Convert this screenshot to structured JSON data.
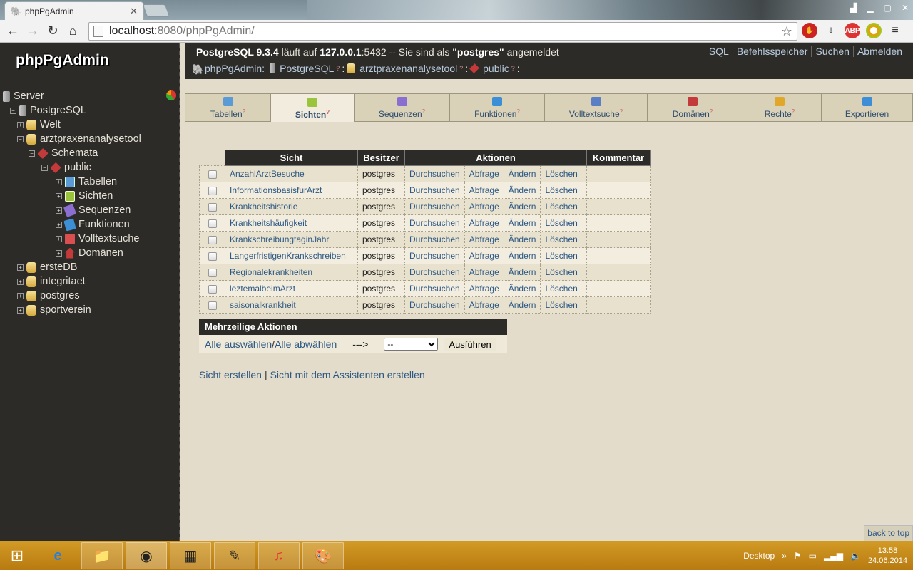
{
  "browser": {
    "tab_title": "phpPgAdmin",
    "url_host": "localhost",
    "url_path": ":8080/phpPgAdmin/"
  },
  "sidebar": {
    "logo": "phpPgAdmin",
    "tree": [
      {
        "label": "Server",
        "icon": "server-icon"
      },
      {
        "label": "PostgreSQL",
        "icon": "server-icon"
      },
      {
        "label": "Welt",
        "icon": "database-icon"
      },
      {
        "label": "arztpraxenanalysetool",
        "icon": "database-icon"
      },
      {
        "label": "Schemata",
        "icon": "schemas-icon"
      },
      {
        "label": "public",
        "icon": "schema-icon"
      },
      {
        "label": "Tabellen",
        "icon": "tables-icon"
      },
      {
        "label": "Sichten",
        "icon": "views-icon"
      },
      {
        "label": "Sequenzen",
        "icon": "sequences-icon"
      },
      {
        "label": "Funktionen",
        "icon": "functions-icon"
      },
      {
        "label": "Volltextsuche",
        "icon": "fulltext-icon"
      },
      {
        "label": "Domänen",
        "icon": "domains-icon"
      },
      {
        "label": "ersteDB",
        "icon": "database-icon"
      },
      {
        "label": "integritaet",
        "icon": "database-icon"
      },
      {
        "label": "postgres",
        "icon": "database-icon"
      },
      {
        "label": "sportverein",
        "icon": "database-icon"
      }
    ]
  },
  "topbar": {
    "version": "PostgreSQL 9.3.4",
    "runs_on": " läuft auf ",
    "host": "127.0.0.1",
    "port": ":5432 -- Sie sind als ",
    "user": "\"postgres\"",
    "logged": " angemeldet",
    "links": [
      "SQL",
      "Befehlsspeicher",
      "Suchen",
      "Abmelden"
    ],
    "crumbs": [
      "phpPgAdmin:",
      "PostgreSQL",
      "arztpraxenanalysetool",
      "public"
    ]
  },
  "tabs": [
    {
      "label": "Tabellen",
      "help": "?",
      "color": "#5b9bd5"
    },
    {
      "label": "Sichten",
      "help": "?",
      "color": "#9ac43c"
    },
    {
      "label": "Sequenzen",
      "help": "?",
      "color": "#8a6fd0"
    },
    {
      "label": "Funktionen",
      "help": "?",
      "color": "#3c8fd6"
    },
    {
      "label": "Volltextsuche",
      "help": "?",
      "color": "#5b7fc4"
    },
    {
      "label": "Domänen",
      "help": "?",
      "color": "#c43a3a"
    },
    {
      "label": "Rechte",
      "help": "?",
      "color": "#e1a72a"
    },
    {
      "label": "Exportieren",
      "help": "",
      "color": "#3c8fd6"
    }
  ],
  "views_table": {
    "headers": [
      "Sicht",
      "Besitzer",
      "Aktionen",
      "Kommentar"
    ],
    "actions": [
      "Durchsuchen",
      "Abfrage",
      "Ändern",
      "Löschen"
    ],
    "rows": [
      {
        "name": "AnzahlArztBesuche",
        "owner": "postgres"
      },
      {
        "name": "InformationsbasisfurArzt",
        "owner": "postgres"
      },
      {
        "name": "Krankheitshistorie",
        "owner": "postgres"
      },
      {
        "name": "Krankheitshäufigkeit",
        "owner": "postgres"
      },
      {
        "name": "KrankschreibungtaginJahr",
        "owner": "postgres"
      },
      {
        "name": "LangerfristigenKrankschreiben",
        "owner": "postgres"
      },
      {
        "name": "Regionalekrankheiten",
        "owner": "postgres"
      },
      {
        "name": "leztemalbeimArzt",
        "owner": "postgres"
      },
      {
        "name": "saisonalkrankheit",
        "owner": "postgres"
      }
    ]
  },
  "multi": {
    "title": "Mehrzeilige Aktionen",
    "select_all": "Alle auswählen",
    "slash": " / ",
    "deselect_all": "Alle abwählen",
    "arrow": "--->",
    "select_value": "--",
    "execute": "Ausführen"
  },
  "bottom_links": {
    "create": "Sicht erstellen",
    "sep": "|",
    "wizard": "Sicht mit dem Assistenten erstellen"
  },
  "back_to_top": "back to top",
  "taskbar": {
    "desktop": "Desktop",
    "time": "13:58",
    "date": "24.06.2014"
  }
}
